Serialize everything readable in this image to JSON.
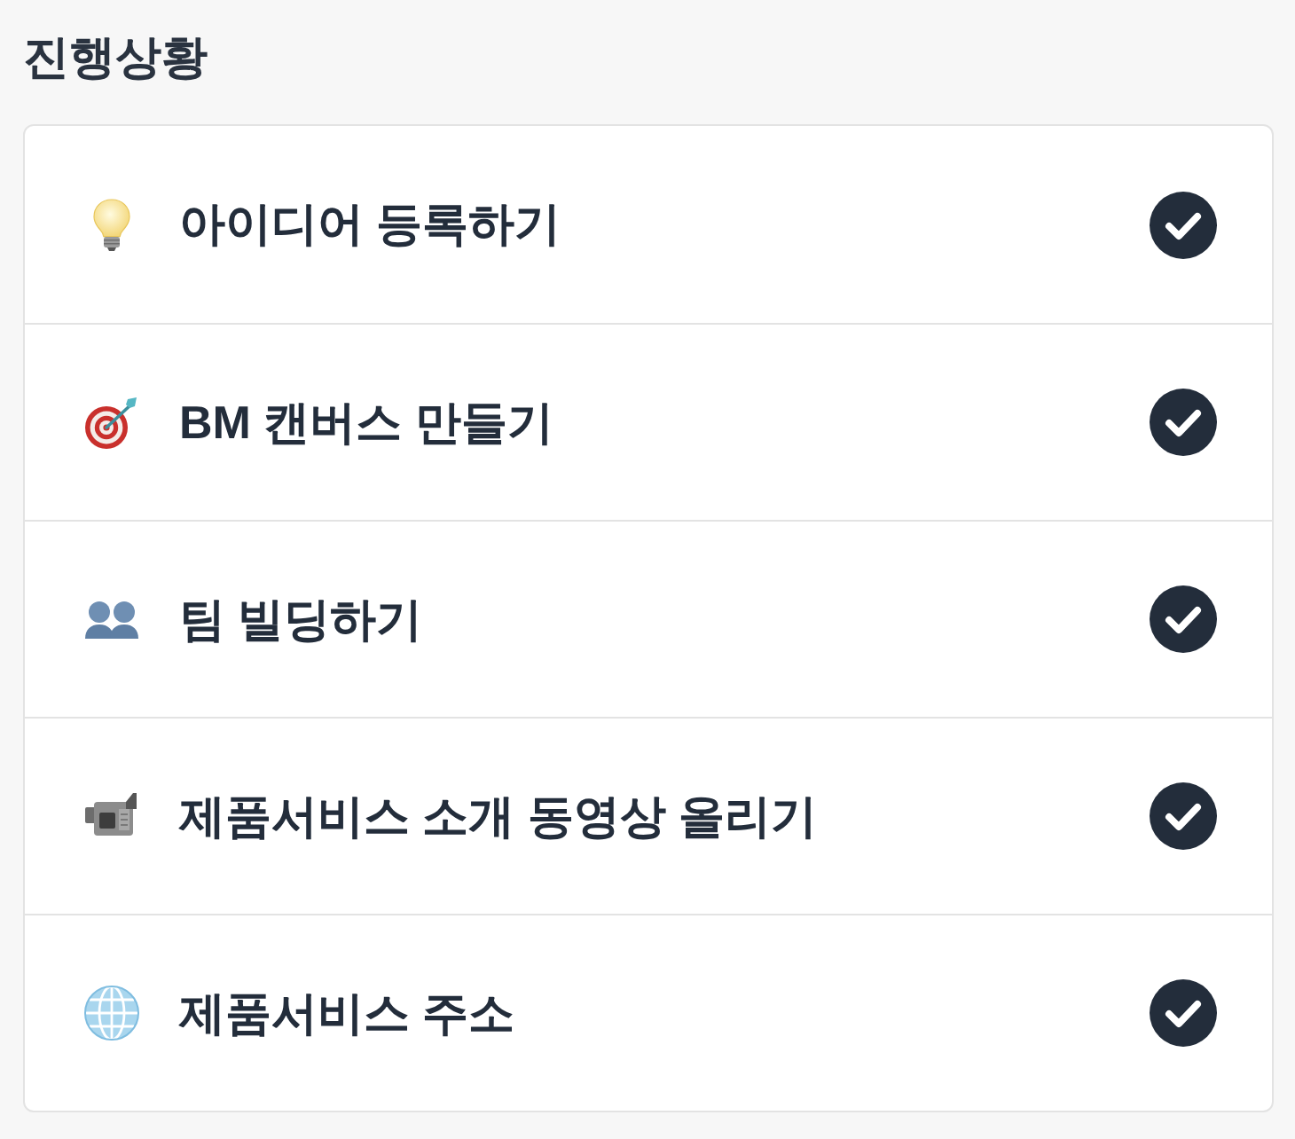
{
  "title": "진행상황",
  "steps": [
    {
      "kind": "bulb",
      "label": "아이디어 등록하기",
      "done": true
    },
    {
      "kind": "target",
      "label": "BM 캔버스 만들기",
      "done": true
    },
    {
      "kind": "people",
      "label": "팀 빌딩하기",
      "done": true
    },
    {
      "kind": "camcorder",
      "label": "제품서비스 소개 동영상 올리기",
      "done": true
    },
    {
      "kind": "globe",
      "label": "제품서비스 주소",
      "done": true
    }
  ]
}
